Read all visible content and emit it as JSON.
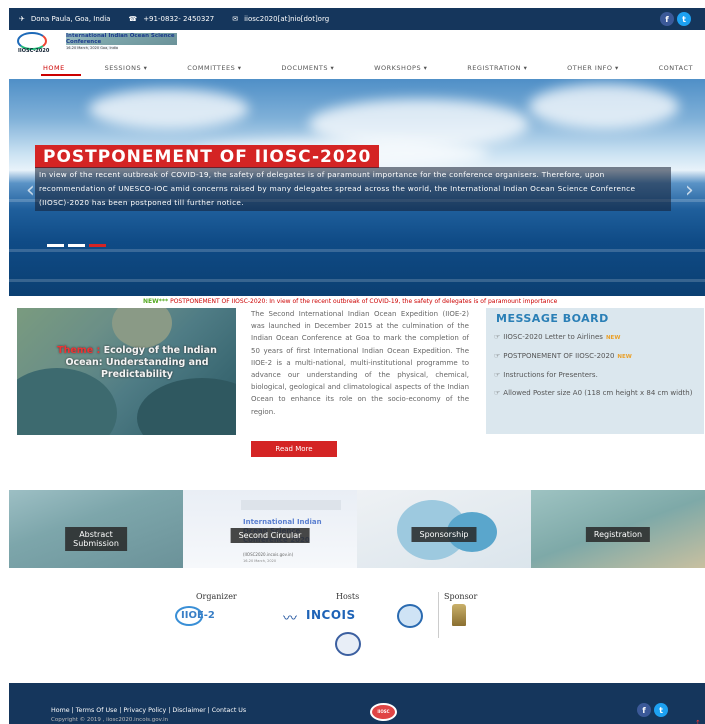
{
  "topbar": {
    "location": "Dona Paula, Goa, India",
    "phone": "+91-0832- 2450327",
    "email": "iiosc2020[at]nio[dot]org"
  },
  "logo": {
    "title": "International Indian Ocean Science Conference",
    "dates": "16-20 March, 2020",
    "place": "Goa, India",
    "tag": "IIOSC-2020"
  },
  "nav": [
    "HOME",
    "SESSIONS ▾",
    "COMMITTEES ▾",
    "DOCUMENTS ▾",
    "WORKSHOPS ▾",
    "REGISTRATION ▾",
    "OTHER INFO ▾",
    "CONTACT"
  ],
  "hero": {
    "title": "POSTPONEMENT OF IIOSC-2020",
    "text": "In view of the recent outbreak of COVID-19, the safety of delegates is of paramount importance for the conference organisers. Therefore, upon recommendation of UNESCO-IOC amid concerns raised by many delegates spread across the world, the International Indian Ocean Science Conference (IIOSC)-2020 has been postponed till further notice."
  },
  "marquee": {
    "badge": "NEW***",
    "text": "POSTPONEMENT OF IIOSC-2020: In view of the recent outbreak of COVID-19, the safety of delegates is of paramount importance"
  },
  "theme": {
    "keyword": "Theme :",
    "text": "Ecology of the Indian Ocean: Understanding and Predictability"
  },
  "about": {
    "text": "The Second International Indian Ocean Expedition (IIOE-2) was launched in December 2015 at the culmination of the Indian Ocean Conference at Goa to mark the completion of 50 years of first International Indian Ocean Expedition. The IIOE-2 is a multi-national, multi-institutional programme to advance our understanding of the physical, chemical, biological, geological and climatological aspects of the Indian Ocean to enhance its role on the socio-economy of the region.",
    "button": "Read More"
  },
  "message_board": {
    "title": "MESSAGE BOARD",
    "items": [
      {
        "text": "IIOSC-2020 Letter to Airlines",
        "new": "NEW"
      },
      {
        "text": "POSTPONEMENT OF IIOSC-2020",
        "new": "NEW"
      },
      {
        "text": "Instructions for Presenters.",
        "new": ""
      },
      {
        "text": "Allowed Poster size A0 (118 cm height x 84 cm width)",
        "new": ""
      }
    ]
  },
  "tiles": {
    "abstract": "Abstract\nSubmission",
    "circular": "Second Circular",
    "sponsorship": "Sponsorship",
    "registration": "Registration",
    "circular_doc_title": "International Indian Ocean Science Conference 2020",
    "circular_doc_url": "(IIOSC2020.incois.gov.in)",
    "circular_doc_date": "16-20 March, 2020"
  },
  "partners": {
    "organizer": "Organizer",
    "hosts": "Hosts",
    "sponsor": "Sponsor",
    "iioe": "IIOE-2",
    "incois": "INCOIS"
  },
  "footer": {
    "links": "Home | Terms Of Use | Privacy Policy | Disclaimer | Contact Us",
    "copyright": "Copyright © 2019 , iiosc2020.incois.gov.in",
    "emblem": "IIOSC"
  }
}
